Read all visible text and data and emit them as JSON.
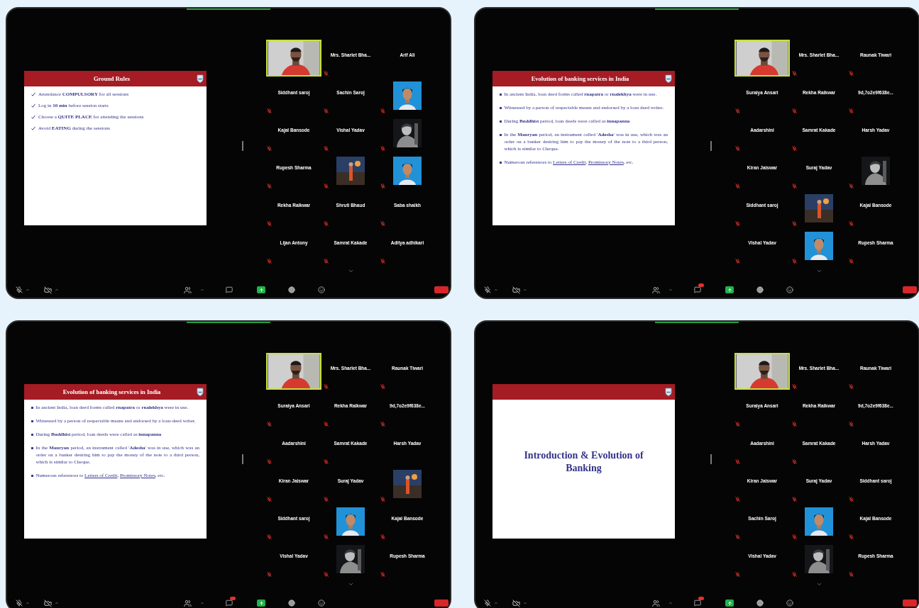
{
  "screens": [
    {
      "chat_unread": false,
      "slide": {
        "kind": "checklist",
        "header": "Ground Rules",
        "bullets": [
          {
            "parts": [
              {
                "text": "Attendance **COMPULSORY** for all sessions",
                "link": false
              }
            ]
          },
          {
            "parts": [
              {
                "text": "Log in **10 min** before session starts",
                "link": false
              }
            ]
          },
          {
            "parts": [
              {
                "text": "Choose a **QUITE PLACE** for attending the sessions",
                "link": false
              }
            ]
          },
          {
            "parts": [
              {
                "text": "Avoid **EATING** during the sessions",
                "link": false
              }
            ]
          }
        ]
      },
      "tiles": [
        {
          "kind": "video",
          "speaking": true,
          "muted": false
        },
        {
          "kind": "name",
          "name": "Mrs. Sharlet Bha...",
          "muted": true
        },
        {
          "kind": "name",
          "name": "Arif Ali",
          "muted": false
        },
        {
          "kind": "name",
          "name": "Siddhant saroj",
          "muted": true
        },
        {
          "kind": "name",
          "name": "Sachin Saroj",
          "muted": true
        },
        {
          "kind": "video",
          "speaking": false,
          "muted": true
        },
        {
          "kind": "name",
          "name": "Kajal Bansode",
          "muted": true
        },
        {
          "kind": "name",
          "name": "Vishal Yadav",
          "muted": true
        },
        {
          "kind": "video",
          "speaking": false,
          "muted": true
        },
        {
          "kind": "name",
          "name": "Rupesh Sharma",
          "muted": true
        },
        {
          "kind": "video",
          "speaking": false,
          "muted": true
        },
        {
          "kind": "video",
          "speaking": false,
          "muted": true
        },
        {
          "kind": "name",
          "name": "Rekha Raikwar",
          "muted": true
        },
        {
          "kind": "name",
          "name": "Shruti Bhaud",
          "muted": true
        },
        {
          "kind": "name",
          "name": "Saba shaikh",
          "muted": true
        },
        {
          "kind": "name",
          "name": "Lijan Antony",
          "muted": true
        },
        {
          "kind": "name",
          "name": "Samrat Kakade",
          "muted": true
        },
        {
          "kind": "name",
          "name": "Aditya adhikari",
          "muted": true
        }
      ]
    },
    {
      "chat_unread": true,
      "slide": {
        "kind": "bullets",
        "header": "Evolution of banking services in India",
        "bullets": [
          {
            "parts": [
              {
                "text": "In ancient India, loan deed forms called **rnapatra** or **rnalekhya** were in use.",
                "link": false
              }
            ]
          },
          {
            "parts": [
              {
                "text": "Witnessed by a person of respectable means and endorsed by a loan deed writer.",
                "link": false
              }
            ]
          },
          {
            "parts": [
              {
                "text": "During **Buddhist** period, loan deeds were called as **innapanna**",
                "link": false
              }
            ]
          },
          {
            "parts": [
              {
                "text": "In the **Mauryan** period, an instrument called '**Adesha**' was in use, which was an order on a banker desiring him to pay the money of the note to a third person, which is similar to Cheque.",
                "link": false
              }
            ]
          },
          {
            "parts": [
              {
                "text": "Numerous references to ",
                "link": false
              },
              {
                "text": "Letters of Credit",
                "link": true
              },
              {
                "text": ", ",
                "link": false
              },
              {
                "text": "Promissory Notes",
                "link": true
              },
              {
                "text": ", etc.",
                "link": false
              }
            ]
          }
        ]
      },
      "tiles": [
        {
          "kind": "video",
          "speaking": true,
          "muted": false
        },
        {
          "kind": "name",
          "name": "Mrs. Sharlet Bha...",
          "muted": true
        },
        {
          "kind": "name",
          "name": "Raunak Tiwari",
          "muted": true
        },
        {
          "kind": "name",
          "name": "Suraiya Ansari",
          "muted": true
        },
        {
          "kind": "name",
          "name": "Rekha Raikwar",
          "muted": true
        },
        {
          "kind": "name",
          "name": "9d,7o2e9f638e...",
          "muted": true
        },
        {
          "kind": "name",
          "name": "Aadarshini",
          "muted": true
        },
        {
          "kind": "name",
          "name": "Samrat Kakade",
          "muted": true
        },
        {
          "kind": "name",
          "name": "Harsh Yadav",
          "muted": false
        },
        {
          "kind": "name",
          "name": "Kiran Jaiswar",
          "muted": true
        },
        {
          "kind": "name",
          "name": "Suraj Yadav",
          "muted": true
        },
        {
          "kind": "video",
          "speaking": false,
          "muted": true
        },
        {
          "kind": "name",
          "name": "Siddhant saroj",
          "muted": true
        },
        {
          "kind": "video",
          "speaking": false,
          "muted": true
        },
        {
          "kind": "name",
          "name": "Kajal Bansode",
          "muted": true
        },
        {
          "kind": "name",
          "name": "Vishal Yadav",
          "muted": true
        },
        {
          "kind": "video",
          "speaking": false,
          "muted": true
        },
        {
          "kind": "name",
          "name": "Rupesh Sharma",
          "muted": true
        }
      ]
    },
    {
      "chat_unread": true,
      "slide": {
        "kind": "bullets",
        "header": "Evolution of banking services in India",
        "bullets": [
          {
            "parts": [
              {
                "text": "In ancient India, loan deed forms called **rnapatra** or **rnalekhya** were in use.",
                "link": false
              }
            ]
          },
          {
            "parts": [
              {
                "text": "Witnessed by a person of respectable means and endorsed by a loan-deed writer.",
                "link": false
              }
            ]
          },
          {
            "parts": [
              {
                "text": "During **Buddhist** period, loan deeds were called as **innapanna**",
                "link": false
              }
            ]
          },
          {
            "parts": [
              {
                "text": "In the **Mauryan** period, an instrument called '**Adesha**' was in use, which was an order on a banker desiring him to pay the money of the note to a third person, which is similar to Cheque.",
                "link": false
              }
            ]
          },
          {
            "parts": [
              {
                "text": "Numerous references to ",
                "link": false
              },
              {
                "text": "Letters of Credit",
                "link": true
              },
              {
                "text": ", ",
                "link": false
              },
              {
                "text": "Promissory Notes",
                "link": true
              },
              {
                "text": ", etc.",
                "link": false
              }
            ]
          }
        ]
      },
      "tiles": [
        {
          "kind": "video",
          "speaking": true,
          "muted": false
        },
        {
          "kind": "name",
          "name": "Mrs. Sharlet Bha...",
          "muted": true
        },
        {
          "kind": "name",
          "name": "Raunak Tiwari",
          "muted": true
        },
        {
          "kind": "name",
          "name": "Suraiya Ansari",
          "muted": true
        },
        {
          "kind": "name",
          "name": "Rekha Raikwar",
          "muted": true
        },
        {
          "kind": "name",
          "name": "9d,7o2e9f638e...",
          "muted": true
        },
        {
          "kind": "name",
          "name": "Aadarshini",
          "muted": true
        },
        {
          "kind": "name",
          "name": "Samrat Kakade",
          "muted": true
        },
        {
          "kind": "name",
          "name": "Harsh Yadav",
          "muted": false
        },
        {
          "kind": "name",
          "name": "Kiran Jaiswar",
          "muted": true
        },
        {
          "kind": "name",
          "name": "Suraj Yadav",
          "muted": true
        },
        {
          "kind": "video",
          "speaking": false,
          "muted": true
        },
        {
          "kind": "name",
          "name": "Siddhant saroj",
          "muted": true
        },
        {
          "kind": "video",
          "speaking": false,
          "muted": true
        },
        {
          "kind": "name",
          "name": "Kajal Bansode",
          "muted": true
        },
        {
          "kind": "name",
          "name": "Vishal Yadav",
          "muted": true
        },
        {
          "kind": "video",
          "speaking": false,
          "muted": true
        },
        {
          "kind": "name",
          "name": "Rupesh Sharma",
          "muted": true
        }
      ]
    },
    {
      "chat_unread": true,
      "slide": {
        "kind": "title",
        "title": "Introduction & Evolution of Banking"
      },
      "tiles": [
        {
          "kind": "video",
          "speaking": true,
          "muted": false
        },
        {
          "kind": "name",
          "name": "Mrs. Sharlet Bha...",
          "muted": true
        },
        {
          "kind": "name",
          "name": "Raunak Tiwari",
          "muted": true
        },
        {
          "kind": "name",
          "name": "Suraiya Ansari",
          "muted": true
        },
        {
          "kind": "name",
          "name": "Rekha Raikwar",
          "muted": true
        },
        {
          "kind": "name",
          "name": "9d,7o2e9f638e...",
          "muted": true
        },
        {
          "kind": "name",
          "name": "Aadarshini",
          "muted": true
        },
        {
          "kind": "name",
          "name": "Samrat Kakade",
          "muted": true
        },
        {
          "kind": "name",
          "name": "Harsh Yadav",
          "muted": false
        },
        {
          "kind": "name",
          "name": "Kiran Jaiswar",
          "muted": true
        },
        {
          "kind": "name",
          "name": "Suraj Yadav",
          "muted": true
        },
        {
          "kind": "name",
          "name": "Siddhant saroj",
          "muted": true
        },
        {
          "kind": "name",
          "name": "Sachin Saroj",
          "muted": true
        },
        {
          "kind": "video",
          "speaking": false,
          "muted": true
        },
        {
          "kind": "name",
          "name": "Kajal Bansode",
          "muted": true
        },
        {
          "kind": "name",
          "name": "Vishal Yadav",
          "muted": true
        },
        {
          "kind": "video",
          "speaking": false,
          "muted": true
        },
        {
          "kind": "name",
          "name": "Rupesh Sharma",
          "muted": true
        }
      ]
    }
  ]
}
